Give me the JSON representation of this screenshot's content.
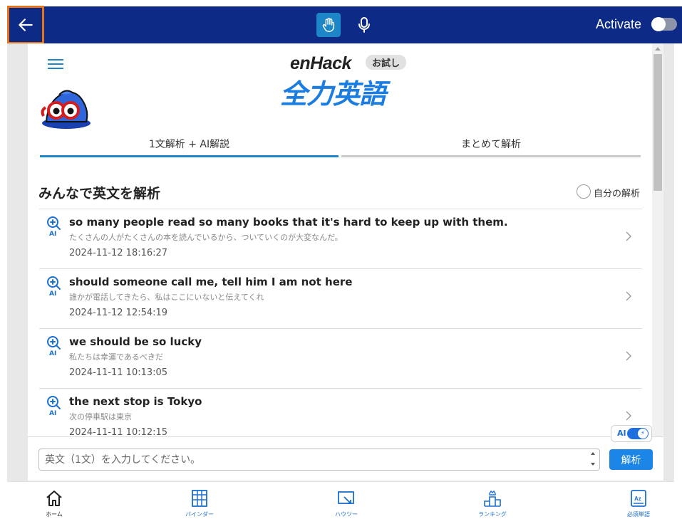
{
  "topbar": {
    "back_icon": "arrow-left-icon",
    "hand_icon": "hand-icon",
    "mic_icon": "microphone-icon",
    "activate_label": "Activate",
    "activate_on": false
  },
  "header": {
    "logo_en": "enHack",
    "logo_trial": "お試し",
    "logo_main": "全力英語"
  },
  "tabs": [
    {
      "label": "1文解析 + AI解説",
      "active": true
    },
    {
      "label": "まとめて解析",
      "active": false
    }
  ],
  "section": {
    "title": "みんなで英文を解析",
    "own_label": "自分の解析"
  },
  "items": [
    {
      "ai": "AI",
      "en": "so many people read so many books that it's hard to keep up with them.",
      "ja": "たくさんの人がたくさんの本を読んでいるから、ついていくのが大変なんだ。",
      "ts": "2024-11-12 18:16:27"
    },
    {
      "ai": "AI",
      "en": "should someone call me, tell him I am not here",
      "ja": "誰かが電話してきたら、私はここにいないと伝えてくれ",
      "ts": "2024-11-12 12:54:19"
    },
    {
      "ai": "AI",
      "en": "we should be so lucky",
      "ja": "私たちは幸運であるべきだ",
      "ts": "2024-11-11 10:13:05"
    },
    {
      "ai": "AI",
      "en": "the next stop is Tokyo",
      "ja": "次の停車駅は東京",
      "ts": "2024-11-11 10:12:15"
    }
  ],
  "input": {
    "ai_label": "AI",
    "ai_on": true,
    "placeholder": "英文（1文）を入力してください。",
    "submit_label": "解析"
  },
  "nav": [
    {
      "label": "ホーム",
      "icon": "home-icon"
    },
    {
      "label": "バインダー",
      "icon": "binder-icon"
    },
    {
      "label": "ハウツー",
      "icon": "howto-icon"
    },
    {
      "label": "ランキング",
      "icon": "ranking-icon"
    },
    {
      "label": "必須単語",
      "icon": "vocabulary-icon"
    }
  ],
  "colors": {
    "topbar": "#0c2a86",
    "accent": "#1b86e8",
    "highlight": "#e8741a"
  }
}
